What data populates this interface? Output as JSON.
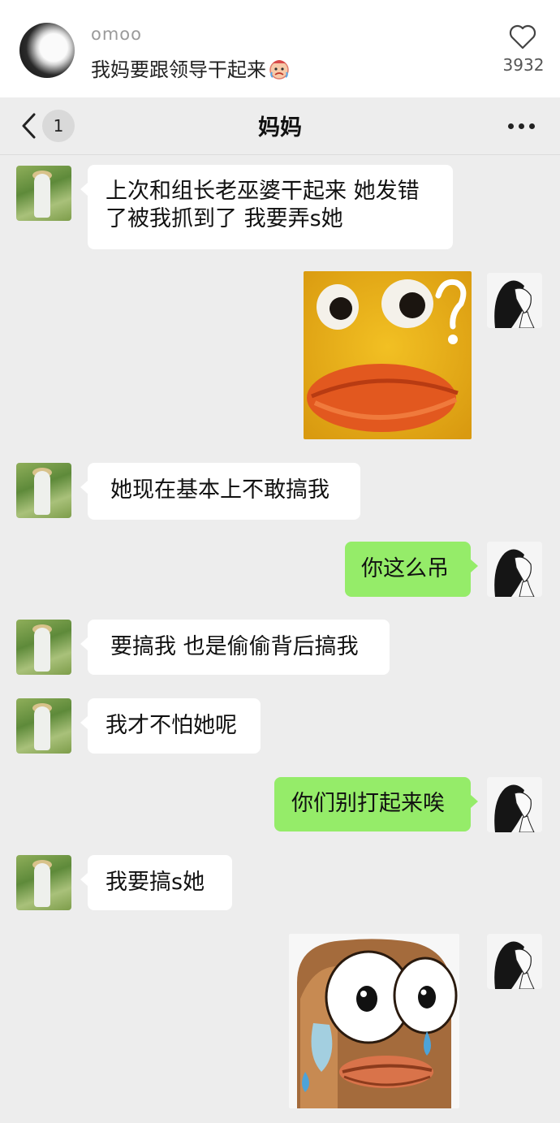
{
  "post": {
    "username": "omoo",
    "title": "我妈要跟领导干起来",
    "title_emoji": "crying-face-emoji",
    "like_count": "3932",
    "like_icon": "heart-outline-icon"
  },
  "chat_header": {
    "back_icon": "chevron-left-icon",
    "unread_count": "1",
    "title": "妈妈",
    "more_icon": "ellipsis-icon"
  },
  "messages": [
    {
      "sender": "mom",
      "type": "text",
      "lines": [
        "上次和组长老巫婆干起来 她发错",
        "了被我抓到了 我要弄s她"
      ]
    },
    {
      "sender": "me",
      "type": "sticker",
      "sticker": "duck-question-mark-sticker"
    },
    {
      "sender": "mom",
      "type": "text",
      "text": "她现在基本上不敢搞我"
    },
    {
      "sender": "me",
      "type": "text",
      "text": "你这么吊"
    },
    {
      "sender": "mom",
      "type": "text",
      "text": "要搞我 也是偷偷背后搞我"
    },
    {
      "sender": "mom",
      "type": "text",
      "text": "我才不怕她呢"
    },
    {
      "sender": "me",
      "type": "text",
      "text": "你们别打起来唉"
    },
    {
      "sender": "mom",
      "type": "text",
      "text": "我要搞s她"
    },
    {
      "sender": "me",
      "type": "sticker",
      "sticker": "crying-frog-sticker"
    }
  ],
  "colors": {
    "chat_background": "#ededed",
    "incoming_bubble": "#ffffff",
    "outgoing_bubble": "#95ec69",
    "header_background": "#ffffff"
  }
}
